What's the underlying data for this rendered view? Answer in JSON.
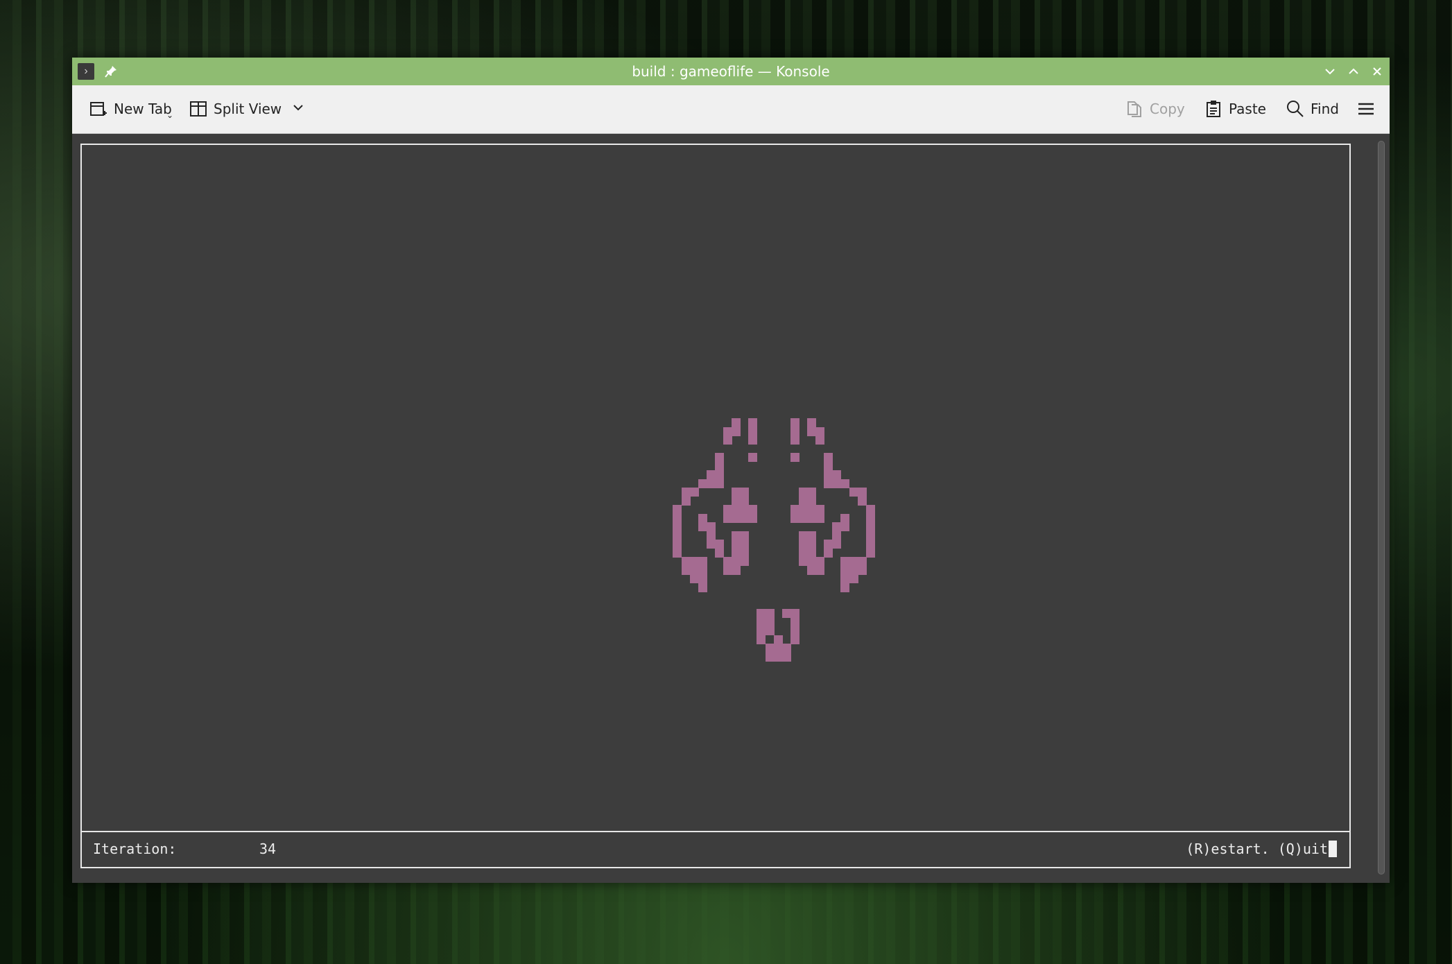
{
  "window": {
    "title": "build : gameoflife — Konsole"
  },
  "toolbar": {
    "new_tab": "New Tab",
    "split_view": "Split View",
    "copy": "Copy",
    "paste": "Paste",
    "find": "Find"
  },
  "status": {
    "iteration_label": "Iteration:",
    "iteration_value": "34",
    "keys": "(R)estart. (Q)uit"
  },
  "colors": {
    "titlebar": "#8fbc72",
    "terminal_bg": "#3d3d3d",
    "cell": "#a56b91"
  },
  "grid": {
    "comment_units": "live cells as [col,row] in game-board cells",
    "cells": [
      [
        51,
        0
      ],
      [
        53,
        0
      ],
      [
        58,
        0
      ],
      [
        60,
        0
      ],
      [
        50,
        1
      ],
      [
        51,
        1
      ],
      [
        53,
        1
      ],
      [
        58,
        1
      ],
      [
        60,
        1
      ],
      [
        61,
        1
      ],
      [
        50,
        2
      ],
      [
        53,
        2
      ],
      [
        58,
        2
      ],
      [
        61,
        2
      ],
      [
        49,
        4
      ],
      [
        53,
        4
      ],
      [
        58,
        4
      ],
      [
        62,
        4
      ],
      [
        49,
        5
      ],
      [
        62,
        5
      ],
      [
        48,
        6
      ],
      [
        49,
        6
      ],
      [
        62,
        6
      ],
      [
        63,
        6
      ],
      [
        47,
        7
      ],
      [
        48,
        7
      ],
      [
        49,
        7
      ],
      [
        62,
        7
      ],
      [
        63,
        7
      ],
      [
        64,
        7
      ],
      [
        45,
        8
      ],
      [
        46,
        8
      ],
      [
        51,
        8
      ],
      [
        52,
        8
      ],
      [
        59,
        8
      ],
      [
        60,
        8
      ],
      [
        65,
        8
      ],
      [
        66,
        8
      ],
      [
        45,
        9
      ],
      [
        51,
        9
      ],
      [
        52,
        9
      ],
      [
        59,
        9
      ],
      [
        60,
        9
      ],
      [
        66,
        9
      ],
      [
        44,
        10
      ],
      [
        50,
        10
      ],
      [
        51,
        10
      ],
      [
        52,
        10
      ],
      [
        53,
        10
      ],
      [
        58,
        10
      ],
      [
        59,
        10
      ],
      [
        60,
        10
      ],
      [
        61,
        10
      ],
      [
        67,
        10
      ],
      [
        44,
        11
      ],
      [
        47,
        11
      ],
      [
        50,
        11
      ],
      [
        51,
        11
      ],
      [
        52,
        11
      ],
      [
        53,
        11
      ],
      [
        58,
        11
      ],
      [
        59,
        11
      ],
      [
        60,
        11
      ],
      [
        61,
        11
      ],
      [
        64,
        11
      ],
      [
        67,
        11
      ],
      [
        44,
        12
      ],
      [
        47,
        12
      ],
      [
        48,
        12
      ],
      [
        63,
        12
      ],
      [
        64,
        12
      ],
      [
        67,
        12
      ],
      [
        44,
        13
      ],
      [
        48,
        13
      ],
      [
        51,
        13
      ],
      [
        52,
        13
      ],
      [
        59,
        13
      ],
      [
        60,
        13
      ],
      [
        63,
        13
      ],
      [
        67,
        13
      ],
      [
        44,
        14
      ],
      [
        48,
        14
      ],
      [
        49,
        14
      ],
      [
        51,
        14
      ],
      [
        52,
        14
      ],
      [
        59,
        14
      ],
      [
        60,
        14
      ],
      [
        62,
        14
      ],
      [
        63,
        14
      ],
      [
        67,
        14
      ],
      [
        44,
        15
      ],
      [
        49,
        15
      ],
      [
        51,
        15
      ],
      [
        52,
        15
      ],
      [
        59,
        15
      ],
      [
        60,
        15
      ],
      [
        62,
        15
      ],
      [
        67,
        15
      ],
      [
        45,
        16
      ],
      [
        46,
        16
      ],
      [
        47,
        16
      ],
      [
        50,
        16
      ],
      [
        51,
        16
      ],
      [
        52,
        16
      ],
      [
        59,
        16
      ],
      [
        60,
        16
      ],
      [
        61,
        16
      ],
      [
        64,
        16
      ],
      [
        65,
        16
      ],
      [
        66,
        16
      ],
      [
        45,
        17
      ],
      [
        46,
        17
      ],
      [
        47,
        17
      ],
      [
        50,
        17
      ],
      [
        51,
        17
      ],
      [
        60,
        17
      ],
      [
        61,
        17
      ],
      [
        64,
        17
      ],
      [
        65,
        17
      ],
      [
        66,
        17
      ],
      [
        46,
        18
      ],
      [
        47,
        18
      ],
      [
        64,
        18
      ],
      [
        65,
        18
      ],
      [
        47,
        19
      ],
      [
        64,
        19
      ],
      [
        54,
        22
      ],
      [
        55,
        22
      ],
      [
        57,
        22
      ],
      [
        58,
        22
      ],
      [
        54,
        23
      ],
      [
        55,
        23
      ],
      [
        58,
        23
      ],
      [
        54,
        24
      ],
      [
        55,
        24
      ],
      [
        58,
        24
      ],
      [
        54,
        25
      ],
      [
        56,
        25
      ],
      [
        58,
        25
      ],
      [
        55,
        26
      ],
      [
        56,
        26
      ],
      [
        57,
        26
      ],
      [
        55,
        27
      ],
      [
        56,
        27
      ],
      [
        57,
        27
      ]
    ]
  }
}
